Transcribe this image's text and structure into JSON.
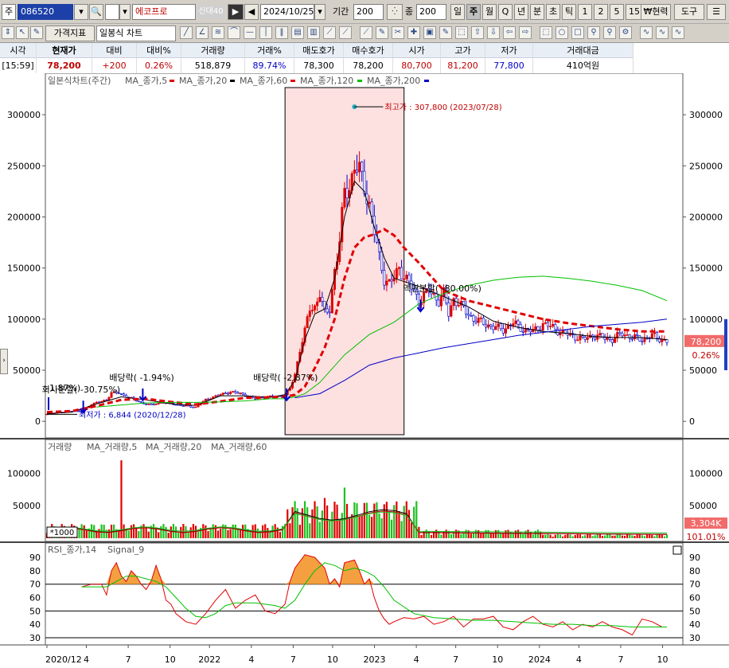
{
  "toolbar": {
    "market_label": "주",
    "code_value": "086520",
    "name_value": "에코프로",
    "tag_label": "신대40",
    "date_value": "2024/10/25",
    "period_label": "기간",
    "period_value": "200",
    "count_label": "종",
    "count_value": "200",
    "period_buttons": [
      "일",
      "주",
      "월",
      "Q",
      "년",
      "분",
      "초",
      "틱",
      "1",
      "2",
      "5",
      "15"
    ],
    "active_period": "주",
    "currency_btn": "₩현력",
    "tools_btn": "도구"
  },
  "toolbar2": {
    "indicator_btn": "가격지표",
    "chart_type_select": "일봉식 차트"
  },
  "quote": {
    "headers": [
      "시각",
      "현재가",
      "대비",
      "대비%",
      "거래량",
      "거래%",
      "매도호가",
      "매수호가",
      "시가",
      "고가",
      "저가",
      "거래대금"
    ],
    "values": [
      "[15:59]",
      "78,200",
      "+200",
      "0.26%",
      "518,879",
      "89.74%",
      "78,300",
      "78,200",
      "80,700",
      "81,200",
      "77,800",
      "410억원"
    ]
  },
  "colors": {
    "up": "#e00000",
    "down": "#0000c8",
    "ma5": "#000000",
    "ma20": "#e00000",
    "ma60": "#00c000",
    "ma200": "#0000c8",
    "highlight": "#fde0e0",
    "rsi": "#e00000",
    "signal": "#00c000",
    "rsi_fill": "#f4a040"
  },
  "chart_data": [
    {
      "type": "line",
      "panel": "price",
      "title": "일본식차트(주간)",
      "legend": [
        "MA_종가,5",
        "MA_종가,20",
        "MA_종가,60",
        "MA_종가,120",
        "MA_종가,200"
      ],
      "x_ticks": [
        "2020/12",
        "4",
        "7",
        "10",
        "2022",
        "4",
        "7",
        "10",
        "2023",
        "4",
        "7",
        "10",
        "2024",
        "4",
        "7",
        "10"
      ],
      "y_ticks": [
        0,
        50000,
        100000,
        150000,
        200000,
        250000,
        300000
      ],
      "ylim": [
        -10000,
        325000
      ],
      "series": [
        {
          "name": "종가",
          "x": [
            0,
            3,
            7,
            11,
            14,
            18,
            22,
            24,
            26,
            29,
            34,
            38,
            42,
            46,
            50,
            54,
            60,
            64,
            67,
            70,
            74,
            78,
            81,
            84,
            88,
            92,
            96,
            98,
            100,
            102,
            104,
            106,
            108,
            110,
            112,
            114,
            116,
            117,
            118,
            120,
            122,
            124,
            126,
            128,
            130,
            132,
            134,
            136,
            138,
            140,
            142,
            146,
            150,
            154,
            158,
            160,
            162,
            164,
            168,
            172,
            176,
            180,
            184,
            188,
            192,
            196,
            200,
            204,
            208,
            212,
            216,
            220,
            224,
            228,
            232,
            236,
            240,
            244,
            248,
            250
          ],
          "values": [
            7000,
            8500,
            9000,
            10500,
            9000,
            17000,
            19500,
            21000,
            28000,
            27500,
            22500,
            18000,
            16000,
            18500,
            17500,
            15500,
            14000,
            21000,
            24000,
            26000,
            29000,
            27000,
            24500,
            22000,
            24000,
            24000,
            26000,
            32000,
            46000,
            70000,
            88000,
            110000,
            112000,
            125000,
            105000,
            110000,
            148000,
            160000,
            175000,
            225000,
            230000,
            248000,
            245000,
            230000,
            212000,
            185000,
            160000,
            140000,
            135000,
            140000,
            150000,
            135000,
            118000,
            128000,
            118000,
            125000,
            105000,
            120000,
            110000,
            100000,
            96000,
            92000,
            90000,
            96000,
            90000,
            88000,
            95000,
            92000,
            86000,
            84000,
            80000,
            84000,
            82000,
            80000,
            86000,
            82000,
            80000,
            84000,
            80000,
            78200
          ]
        },
        {
          "name": "MA_종가,5",
          "x": [
            0,
            10,
            20,
            30,
            40,
            50,
            60,
            70,
            80,
            90,
            96,
            100,
            104,
            108,
            112,
            116,
            120,
            124,
            128,
            132,
            136,
            140,
            150,
            160,
            170,
            180,
            190,
            200,
            210,
            220,
            230,
            240,
            250
          ],
          "values": [
            7500,
            9000,
            17000,
            24000,
            21000,
            17000,
            15500,
            25000,
            25000,
            23500,
            26000,
            40000,
            80000,
            105000,
            110000,
            140000,
            200000,
            235000,
            225000,
            190000,
            160000,
            140000,
            132000,
            122000,
            112000,
            98000,
            92000,
            88000,
            86000,
            83000,
            82000,
            82000,
            80000
          ]
        },
        {
          "name": "MA_종가,20",
          "x": [
            0,
            10,
            20,
            30,
            40,
            50,
            60,
            70,
            80,
            90,
            96,
            100,
            104,
            108,
            112,
            116,
            120,
            124,
            128,
            132,
            136,
            140,
            144,
            150,
            160,
            170,
            180,
            190,
            200,
            210,
            220,
            230,
            240,
            250
          ],
          "values": [
            9000,
            10000,
            15000,
            21000,
            22000,
            19000,
            16500,
            19500,
            23000,
            23500,
            24000,
            26000,
            34000,
            52000,
            72000,
            100000,
            140000,
            170000,
            180000,
            183000,
            188000,
            182000,
            170000,
            155000,
            128000,
            118000,
            112000,
            106000,
            100000,
            96000,
            93000,
            90000,
            88000,
            88000
          ]
        },
        {
          "name": "MA_종가,60",
          "x": [
            20,
            30,
            40,
            50,
            60,
            70,
            80,
            90,
            96,
            100,
            104,
            110,
            120,
            130,
            140,
            150,
            160,
            170,
            180,
            190,
            200,
            210,
            220,
            230,
            240,
            250
          ],
          "values": [
            14000,
            16000,
            18000,
            18500,
            18500,
            19000,
            20000,
            22000,
            22000,
            24000,
            27000,
            38000,
            65000,
            85000,
            97000,
            115000,
            125000,
            133000,
            138000,
            141000,
            142000,
            140000,
            137000,
            133000,
            128000,
            118000
          ]
        },
        {
          "name": "MA_종가,200",
          "x": [
            100,
            110,
            120,
            130,
            140,
            150,
            160,
            170,
            180,
            190,
            200,
            210,
            220,
            230,
            240,
            250
          ],
          "values": [
            23000,
            27000,
            40000,
            55000,
            62000,
            67000,
            72000,
            76000,
            80000,
            84000,
            87000,
            90000,
            93000,
            95000,
            97000,
            100000
          ]
        }
      ],
      "annotations": [
        {
          "text": "최고가 : 307,800 (2023/07/28)",
          "x": 124,
          "y": 307800
        },
        {
          "text": "최저가 : 6,844 (2020/12/28)",
          "x": 0,
          "y": 6844
        },
        {
          "text": "-1.87%)",
          "x": 0,
          "y": 22000
        },
        {
          "text": "회사분할( -30.75%)",
          "x": 14,
          "y": 28000
        },
        {
          "text": "배당락( -1.94%)",
          "x": 38,
          "y": 40000
        },
        {
          "text": "배당락( -2.87%)",
          "x": 96,
          "y": 40000
        },
        {
          "text": "액면분할( -80.00%)",
          "x": 150,
          "y": 127000
        }
      ],
      "highlight_range": [
        96,
        144
      ],
      "last_price_label": "78,200",
      "last_change_label": "0.26%"
    },
    {
      "type": "bar",
      "panel": "volume",
      "title": "거래량",
      "legend": [
        "거래량",
        "MA_거래량,5",
        "MA_거래량,20",
        "MA_거래량,60"
      ],
      "unit_label": "*1000",
      "y_ticks": [
        50000,
        100000
      ],
      "ylim": [
        0,
        130000
      ],
      "peaks": [
        {
          "x": 30,
          "value": 120000
        },
        {
          "x": 120,
          "value": 78000
        },
        {
          "x": 112,
          "value": 62000
        }
      ],
      "last_value_label": "3,304K",
      "last_pct_label": "101.01%"
    },
    {
      "type": "line",
      "panel": "rsi",
      "title": "RSI_종가,14",
      "legend": [
        "RSI_종가,14",
        "Signal_9"
      ],
      "y_ticks": [
        30,
        40,
        50,
        60,
        70,
        80,
        90
      ],
      "ylim": [
        27,
        96
      ],
      "reference_lines": [
        30,
        50,
        70
      ],
      "series": [
        {
          "name": "RSI_종가,14",
          "x": [
            14,
            18,
            22,
            24,
            26,
            28,
            30,
            32,
            34,
            36,
            38,
            40,
            42,
            44,
            46,
            48,
            50,
            52,
            56,
            60,
            64,
            68,
            72,
            76,
            80,
            84,
            88,
            92,
            96,
            98,
            100,
            104,
            108,
            112,
            114,
            116,
            118,
            120,
            124,
            126,
            128,
            130,
            132,
            134,
            136,
            138,
            140,
            144,
            148,
            152,
            156,
            160,
            164,
            168,
            172,
            176,
            180,
            184,
            188,
            192,
            196,
            200,
            204,
            208,
            212,
            216,
            220,
            224,
            228,
            232,
            236,
            240,
            244,
            248,
            250
          ],
          "values": [
            68,
            70,
            70,
            62,
            80,
            86,
            76,
            72,
            80,
            76,
            70,
            66,
            72,
            84,
            74,
            58,
            55,
            48,
            42,
            40,
            48,
            58,
            66,
            52,
            58,
            62,
            50,
            48,
            55,
            72,
            82,
            92,
            90,
            82,
            70,
            74,
            68,
            86,
            88,
            80,
            70,
            74,
            60,
            50,
            44,
            40,
            42,
            45,
            44,
            46,
            40,
            42,
            46,
            38,
            44,
            44,
            46,
            38,
            36,
            42,
            46,
            40,
            38,
            42,
            36,
            40,
            38,
            42,
            38,
            36,
            32,
            44,
            42,
            38,
            38
          ]
        },
        {
          "name": "Signal_9",
          "x": [
            14,
            20,
            24,
            28,
            32,
            36,
            40,
            44,
            48,
            52,
            56,
            60,
            64,
            68,
            72,
            76,
            80,
            84,
            88,
            92,
            96,
            100,
            104,
            108,
            112,
            116,
            120,
            124,
            128,
            132,
            136,
            140,
            148,
            156,
            164,
            172,
            180,
            188,
            196,
            204,
            212,
            220,
            228,
            236,
            244,
            250
          ],
          "values": [
            68,
            68,
            68,
            72,
            76,
            76,
            74,
            72,
            68,
            60,
            52,
            46,
            45,
            48,
            54,
            56,
            56,
            56,
            55,
            54,
            52,
            58,
            70,
            80,
            86,
            84,
            80,
            82,
            80,
            76,
            68,
            58,
            48,
            45,
            44,
            43,
            43,
            42,
            41,
            40,
            40,
            39,
            39,
            38,
            38,
            38
          ]
        }
      ]
    }
  ]
}
